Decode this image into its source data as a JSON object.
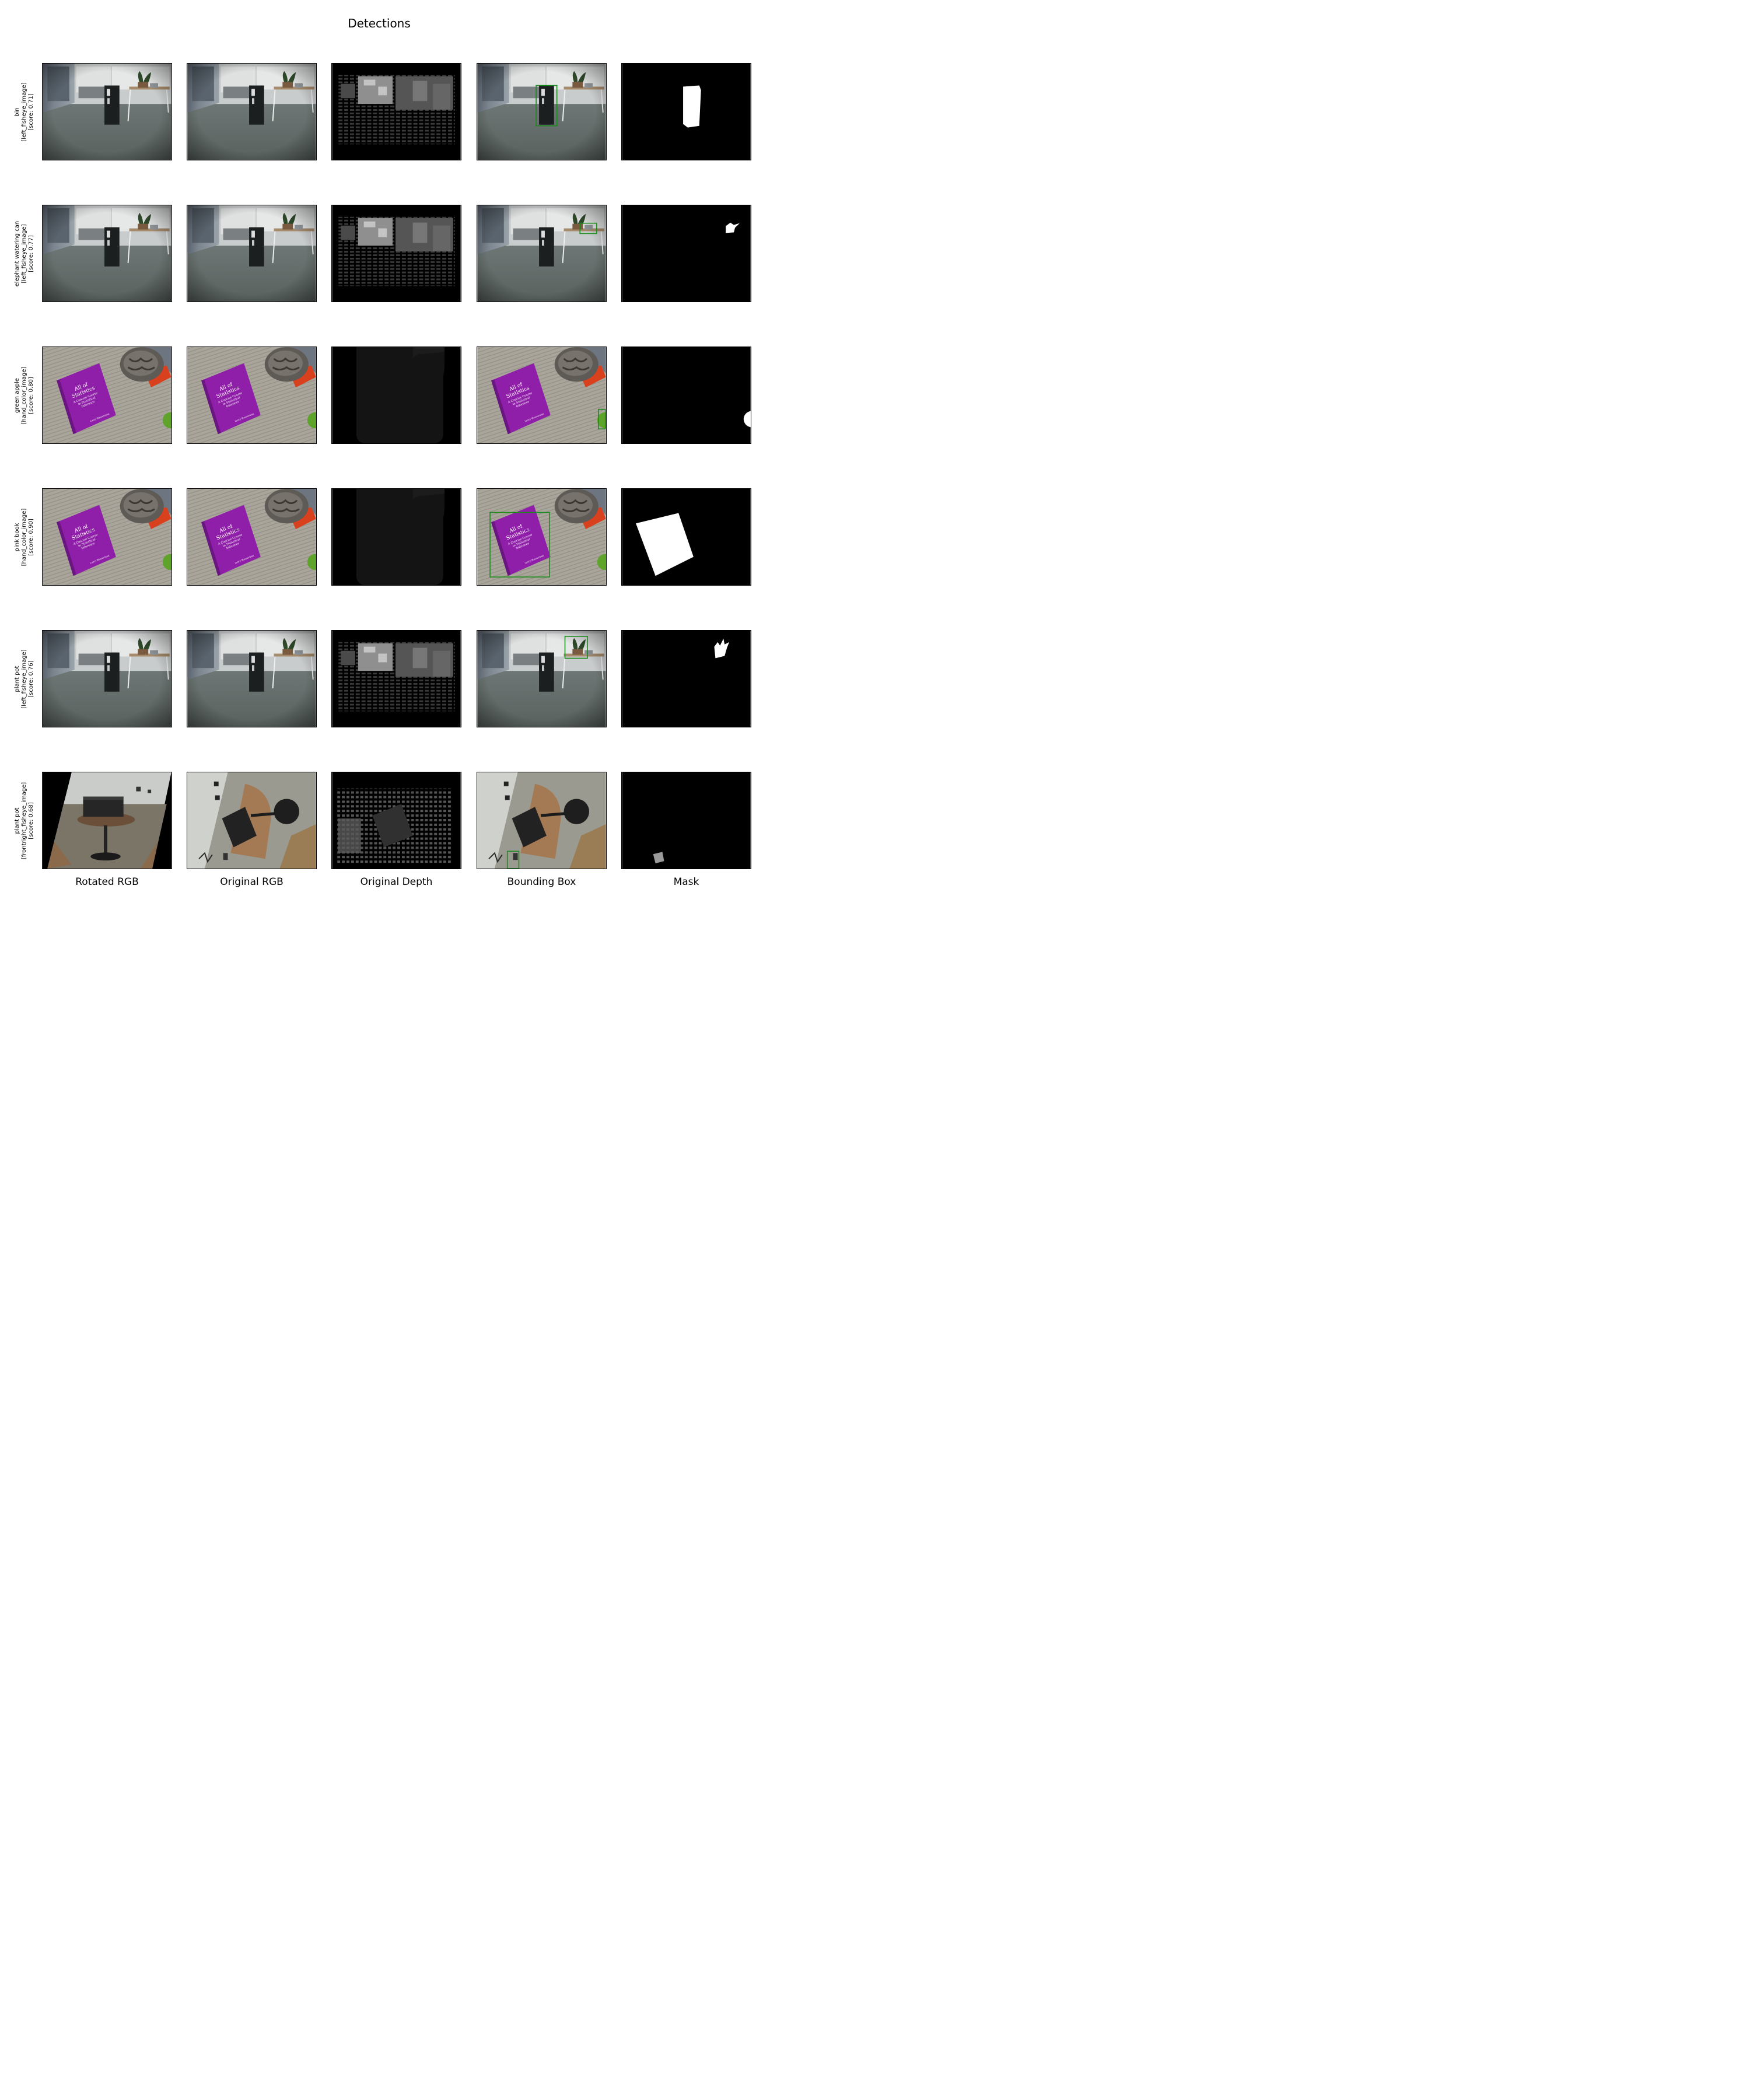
{
  "title": "Detections",
  "columns": [
    "Rotated RGB",
    "Original RGB",
    "Original Depth",
    "Bounding Box",
    "Mask"
  ],
  "rows": [
    {
      "name": "bin",
      "source": "[left_fisheye_image]",
      "score": "[score: 0.71]",
      "scene": "office"
    },
    {
      "name": "elephant watering can",
      "source": "[left_fisheye_image]",
      "score": "[score: 0.77]",
      "scene": "office"
    },
    {
      "name": "green apple",
      "source": "[hand_color_image]",
      "score": "[score: 0.80]",
      "scene": "table"
    },
    {
      "name": "pink book",
      "source": "[hand_color_image]",
      "score": "[score: 0.90]",
      "scene": "table"
    },
    {
      "name": "plant pot",
      "source": "[left_fisheye_image]",
      "score": "[score: 0.76]",
      "scene": "office"
    },
    {
      "name": "plant pot",
      "source": "[frontright_fisheye_image]",
      "score": "[score: 0.68]",
      "scene": "room"
    }
  ],
  "book_text": [
    "All of",
    "Statistics",
    "A Concise Course",
    "in Statistical",
    "Inference",
    "Larry Wasserman"
  ],
  "box_color": "#1a8a1a"
}
